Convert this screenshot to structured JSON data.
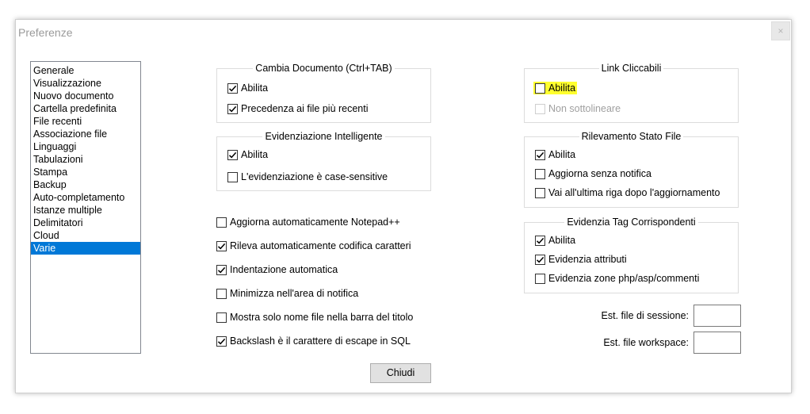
{
  "window": {
    "title": "Preferenze",
    "close_glyph": "×"
  },
  "categories": [
    "Generale",
    "Visualizzazione",
    "Nuovo documento",
    "Cartella predefinita",
    "File recenti",
    "Associazione file",
    "Linguaggi",
    "Tabulazioni",
    "Stampa",
    "Backup",
    "Auto-completamento",
    "Istanze multiple",
    "Delimitatori",
    "Cloud",
    "Varie"
  ],
  "selected_category": "Varie",
  "doc_switcher": {
    "title": "Cambia Documento (Ctrl+TAB)",
    "enable": "Abilita",
    "mru": "Precedenza ai file più recenti"
  },
  "smart_hl": {
    "title": "Evidenziazione Intelligente",
    "enable": "Abilita",
    "case": "L'evidenziazione è case-sensitive"
  },
  "misc": {
    "auto_update": "Aggiorna automaticamente Notepad++",
    "auto_detect": "Rileva automaticamente codifica caratteri",
    "auto_indent": "Indentazione automatica",
    "minimize_tray": "Minimizza nell'area di notifica",
    "short_title": "Mostra solo nome file nella barra del titolo",
    "backslash_sql": "Backslash è il carattere di escape in SQL"
  },
  "clickable_links": {
    "title": "Link Cliccabili",
    "enable": "Abilita",
    "no_underline": "Non sottolineare"
  },
  "file_status": {
    "title": "Rilevamento Stato File",
    "enable": "Abilita",
    "silent": "Aggiorna senza notifica",
    "goto_last": "Vai all'ultima riga dopo l'aggiornamento"
  },
  "tag_match": {
    "title": "Evidenzia Tag Corrispondenti",
    "enable": "Abilita",
    "attributes": "Evidenzia attributi",
    "php_zones": "Evidenzia zone php/asp/commenti"
  },
  "session_ext": {
    "label": "Est. file di sessione:",
    "value": ""
  },
  "workspace_ext": {
    "label": "Est. file workspace:",
    "value": ""
  },
  "close_button": "Chiudi",
  "colors": {
    "selection": "#0078d7",
    "highlight": "#ffff2e"
  }
}
